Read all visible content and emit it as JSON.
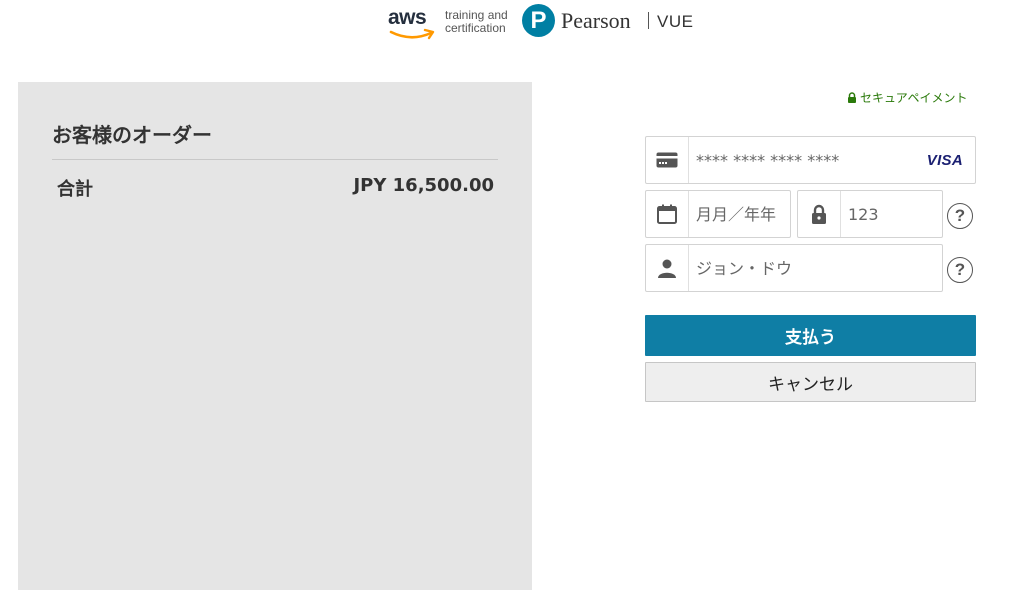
{
  "header": {
    "aws_wordmark": "aws",
    "aws_tagline_line1": "training and",
    "aws_tagline_line2": "certification",
    "pearson_mark": "P",
    "pearson_wordmark": "Pearson",
    "vue_wordmark": "VUE"
  },
  "order": {
    "title": "お客様のオーダー",
    "total_label": "合計",
    "total_amount": "JPY 16,500.00"
  },
  "payment": {
    "secure_label": "セキュアペイメント",
    "card_number_placeholder": "**** **** **** ****",
    "card_brand": "VISA",
    "expiry_placeholder": "月月／年年",
    "cvv_placeholder": "123",
    "name_placeholder": "ジョン・ドウ",
    "help_symbol": "?",
    "pay_label": "支払う",
    "cancel_label": "キャンセル"
  },
  "colors": {
    "brand_teal": "#007fa3",
    "pay_button": "#0f7ea5",
    "secure_green": "#2b7a0b",
    "aws_orange": "#ff9900",
    "panel_gray": "#e5e5e5"
  },
  "icons": {
    "card": "credit-card-icon",
    "expiry": "calendar-icon",
    "cvv": "lock-icon",
    "name": "user-icon",
    "secure": "padlock-icon"
  }
}
